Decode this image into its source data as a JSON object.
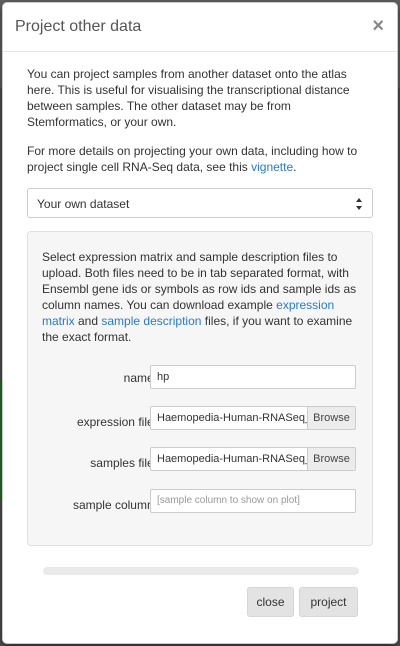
{
  "modal": {
    "title": "Project other data",
    "close_symbol": "×"
  },
  "body": {
    "intro": "You can project samples from another dataset onto the atlas here. This is useful for visualising the transcriptional distance between samples. The other dataset may be from Stemformatics, or your own.",
    "details_prefix": "For more details on projecting your own data, including how to project single cell RNA-Seq data, see this ",
    "details_link": "vignette",
    "details_suffix": "."
  },
  "source_select": {
    "selected": "Your own dataset"
  },
  "panel": {
    "desc_1": "Select expression matrix and sample description files to upload. Both files need to be in tab separated format, with Ensembl gene ids or symbols as row ids and sample ids as column names. You can download example ",
    "link_expression": "expression matrix",
    "desc_2": " and ",
    "link_sample": "sample description",
    "desc_3": " files, if you want to examine the exact format."
  },
  "form": {
    "name_label": "name:",
    "name_value": "hp",
    "expression_label": "expression file:",
    "expression_file": "Haemopedia-Human-RNASeq_cpm.txt",
    "samples_label": "samples file:",
    "samples_file": "Haemopedia-Human-RNASeq_samples.txt",
    "browse_label": "Browse",
    "sample_column_label": "sample column:",
    "sample_column_placeholder": "[sample column to show on plot]"
  },
  "progress": {
    "value": 0
  },
  "footer": {
    "close_label": "close",
    "project_label": "project"
  }
}
